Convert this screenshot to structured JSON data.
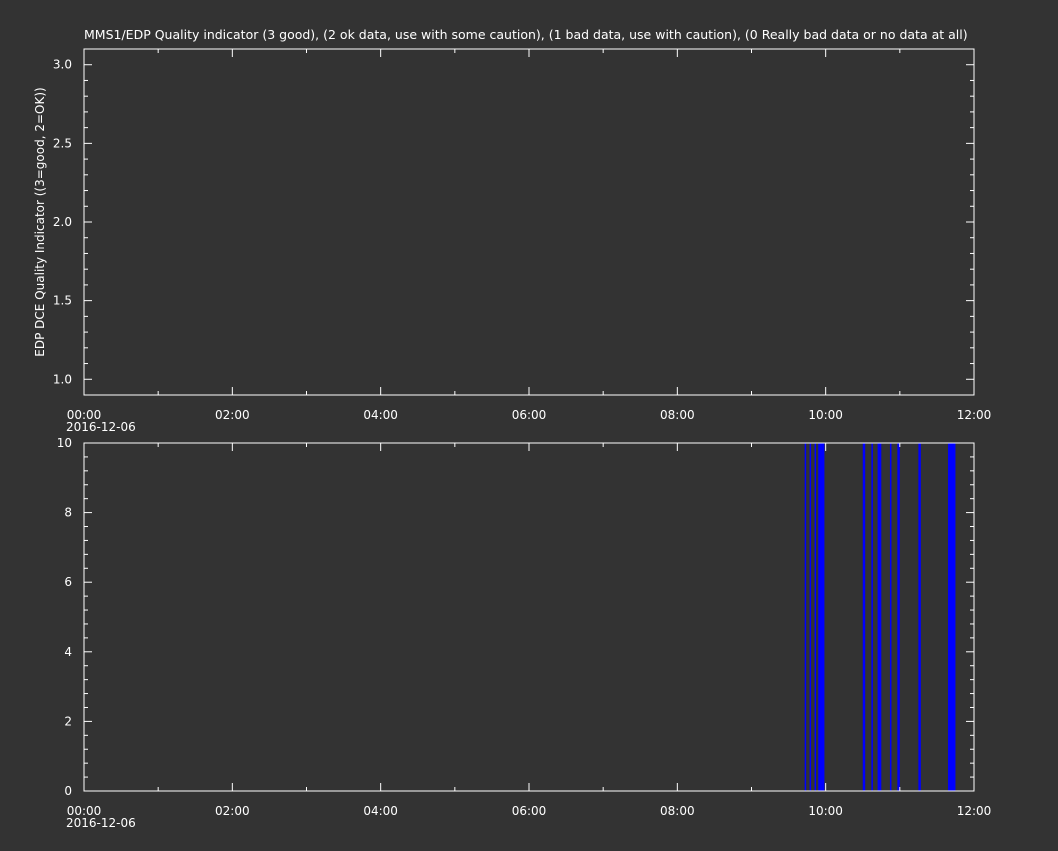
{
  "chart_data": [
    {
      "type": "line",
      "title": "MMS1/EDP  Quality indicator (3 good), (2 ok data, use with some caution), (1 bad data, use with caution), (0 Really bad data or no data at all)",
      "ylabel": "EDP DCE Quality Indicator ((3=good, 2=OK))",
      "xlabel": "",
      "xlim": [
        "00:00",
        "12:00"
      ],
      "ylim": [
        0.9,
        3.1
      ],
      "x_ticks": [
        "00:00",
        "02:00",
        "04:00",
        "06:00",
        "08:00",
        "10:00",
        "12:00"
      ],
      "x_tick_date": "2016-12-06",
      "y_ticks": [
        "1.0",
        "1.5",
        "2.0",
        "2.5",
        "3.0"
      ],
      "series": [],
      "grid": false
    },
    {
      "type": "bar",
      "title": "",
      "ylabel": "",
      "xlabel": "",
      "xlim": [
        "00:00",
        "12:00"
      ],
      "ylim": [
        0,
        10
      ],
      "x_ticks": [
        "00:00",
        "02:00",
        "04:00",
        "06:00",
        "08:00",
        "10:00",
        "12:00"
      ],
      "x_tick_date": "2016-12-06",
      "y_ticks": [
        "0",
        "2",
        "4",
        "6",
        "8",
        "10"
      ],
      "bar_color": "#0000ff",
      "intervals": [
        [
          "09:43",
          "09:44"
        ],
        [
          "09:47",
          "09:48"
        ],
        [
          "09:51",
          "09:52"
        ],
        [
          "09:54",
          "09:59"
        ],
        [
          "10:30",
          "10:32"
        ],
        [
          "10:37",
          "10:38"
        ],
        [
          "10:42",
          "10:45"
        ],
        [
          "10:52",
          "10:53"
        ],
        [
          "10:58",
          "11:00"
        ],
        [
          "11:15",
          "11:17"
        ],
        [
          "11:39",
          "11:45"
        ]
      ],
      "value": 10,
      "grid": false
    }
  ]
}
